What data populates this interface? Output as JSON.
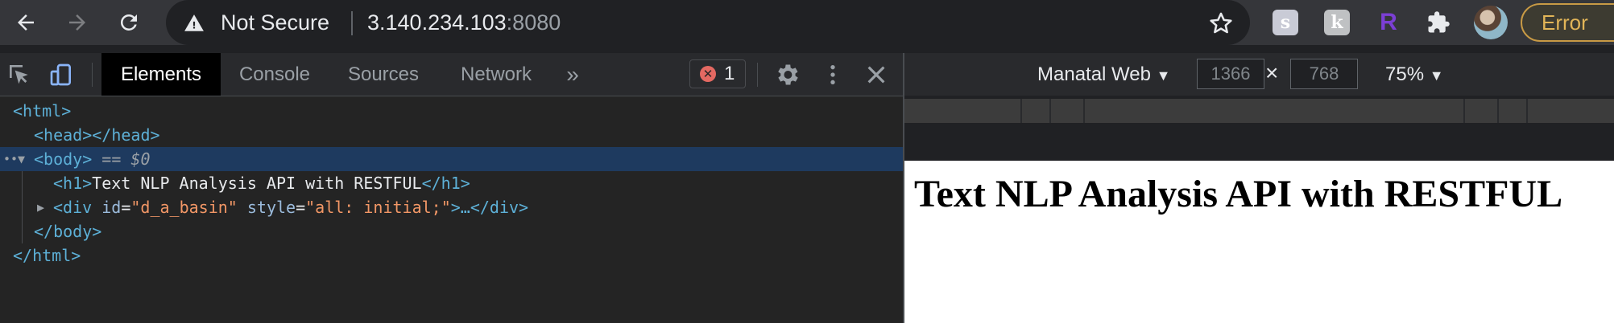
{
  "browser": {
    "security_label": "Not Secure",
    "url_host": "3.140.234.103",
    "url_port": ":8080",
    "error_chip": "Error",
    "extensions": [
      {
        "name": "s-extension",
        "glyph": "s"
      },
      {
        "name": "k-extension",
        "glyph": "k"
      },
      {
        "name": "r-extension",
        "glyph": "R"
      }
    ],
    "colors": {
      "toolbar": "#35363a",
      "omnibox": "#202124",
      "error": "#e2b558"
    }
  },
  "devtools": {
    "tabs": [
      {
        "label": "Elements",
        "active": true
      },
      {
        "label": "Console",
        "active": false
      },
      {
        "label": "Sources",
        "active": false
      },
      {
        "label": "Network",
        "active": false
      }
    ],
    "more_tabs": "»",
    "error_count": "1",
    "dom": {
      "html_open": "<html>",
      "head": "<head></head>",
      "body_open": "<body>",
      "body_marker": "== $0",
      "h1_open": "<h1>",
      "h1_text": "Text NLP Analysis API with RESTFUL",
      "h1_close": "</h1>",
      "div_open_tag": "<div",
      "div_attr1_name": "id",
      "div_attr1_val": "\"d_a_basin\"",
      "div_attr2_name": "style",
      "div_attr2_val": "\"all: initial;\"",
      "div_ellipsis": ">…",
      "div_close": "</div>",
      "body_close": "</body>",
      "html_close": "</html>"
    },
    "colors": {
      "selected_row": "#1e3a5f",
      "tag": "#5db0d7",
      "attr_value": "#f29766"
    }
  },
  "device_toolbar": {
    "device": "Manatal Web",
    "width": "1366",
    "height": "768",
    "zoom": "75%"
  },
  "page": {
    "heading": "Text NLP Analysis API with RESTFUL"
  }
}
